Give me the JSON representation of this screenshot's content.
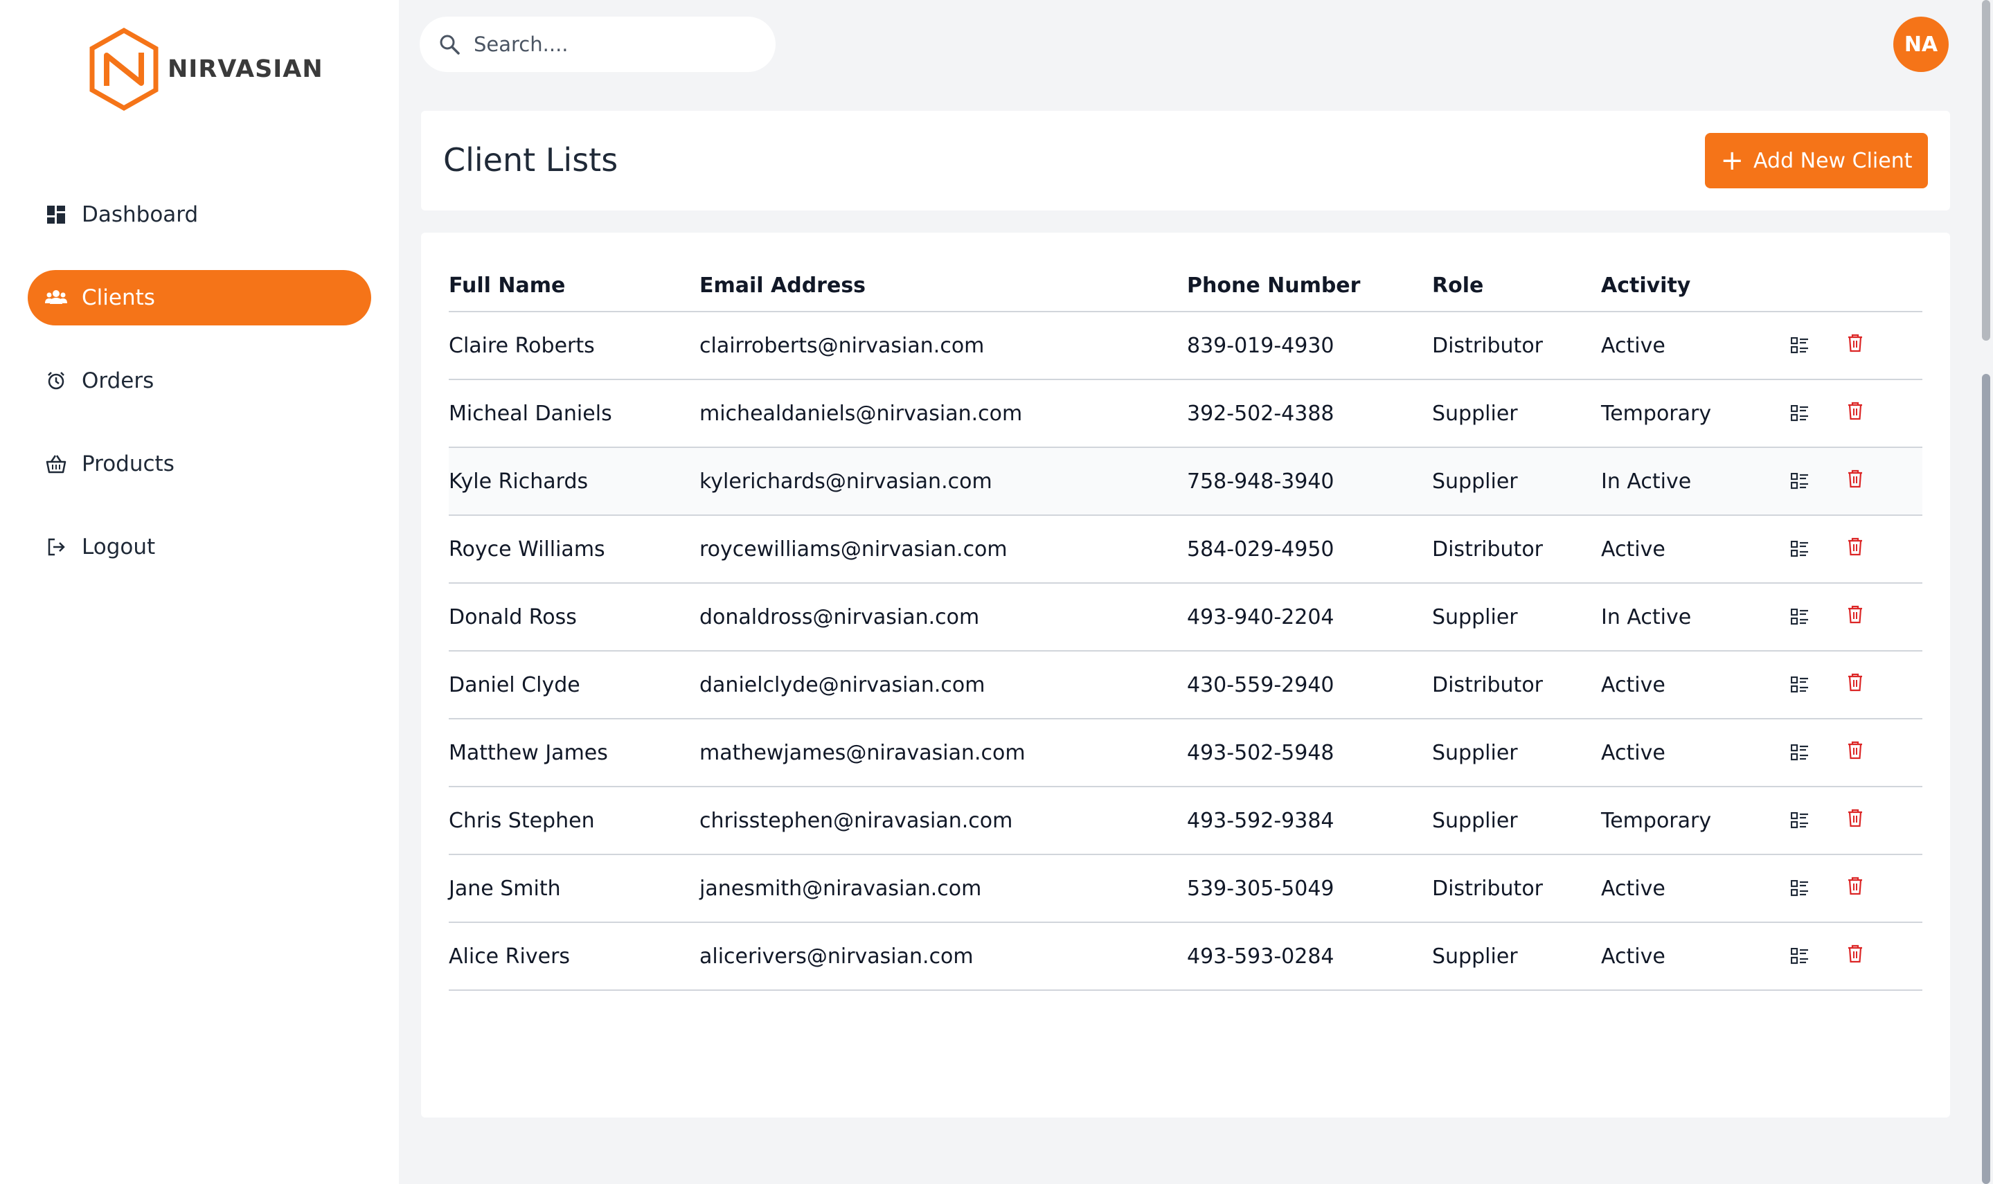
{
  "brand": {
    "name": "NIRVASIAN",
    "accent": "#f57418"
  },
  "sidebar": {
    "items": [
      {
        "label": "Dashboard",
        "icon": "dashboard-icon",
        "active": false
      },
      {
        "label": "Clients",
        "icon": "users-icon",
        "active": true
      },
      {
        "label": "Orders",
        "icon": "alarm-clock-icon",
        "active": false
      },
      {
        "label": "Products",
        "icon": "basket-icon",
        "active": false
      },
      {
        "label": "Logout",
        "icon": "logout-icon",
        "active": false
      }
    ]
  },
  "header": {
    "search_placeholder": "Search....",
    "avatar_initials": "NA"
  },
  "page": {
    "title": "Client Lists",
    "add_button_label": "Add New Client"
  },
  "table": {
    "headers": [
      "Full Name",
      "Email Address",
      "Phone Number",
      "Role",
      "Activity"
    ],
    "rows": [
      {
        "name": "Claire Roberts",
        "email": "clairroberts@nirvasian.com",
        "phone": "839-019-4930",
        "role": "Distributor",
        "activity": "Active"
      },
      {
        "name": "Micheal Daniels",
        "email": "michealdaniels@nirvasian.com",
        "phone": "392-502-4388",
        "role": "Supplier",
        "activity": "Temporary"
      },
      {
        "name": "Kyle Richards",
        "email": "kylerichards@nirvasian.com",
        "phone": "758-948-3940",
        "role": "Supplier",
        "activity": "In Active"
      },
      {
        "name": "Royce Williams",
        "email": "roycewilliams@nirvasian.com",
        "phone": "584-029-4950",
        "role": "Distributor",
        "activity": "Active"
      },
      {
        "name": "Donald Ross",
        "email": "donaldross@nirvasian.com",
        "phone": "493-940-2204",
        "role": "Supplier",
        "activity": "In Active"
      },
      {
        "name": "Daniel Clyde",
        "email": "danielclyde@nirvasian.com",
        "phone": "430-559-2940",
        "role": "Distributor",
        "activity": "Active"
      },
      {
        "name": "Matthew James",
        "email": "mathewjames@niravasian.com",
        "phone": "493-502-5948",
        "role": "Supplier",
        "activity": "Active"
      },
      {
        "name": "Chris Stephen",
        "email": "chrisstephen@niravasian.com",
        "phone": "493-592-9384",
        "role": "Supplier",
        "activity": "Temporary"
      },
      {
        "name": "Jane Smith",
        "email": "janesmith@niravasian.com",
        "phone": "539-305-5049",
        "role": "Distributor",
        "activity": "Active"
      },
      {
        "name": "Alice Rivers",
        "email": "alicerivers@nirvasian.com",
        "phone": "493-593-0284",
        "role": "Supplier",
        "activity": "Active"
      }
    ],
    "row_actions": [
      "details-list-icon",
      "trash-icon"
    ]
  }
}
